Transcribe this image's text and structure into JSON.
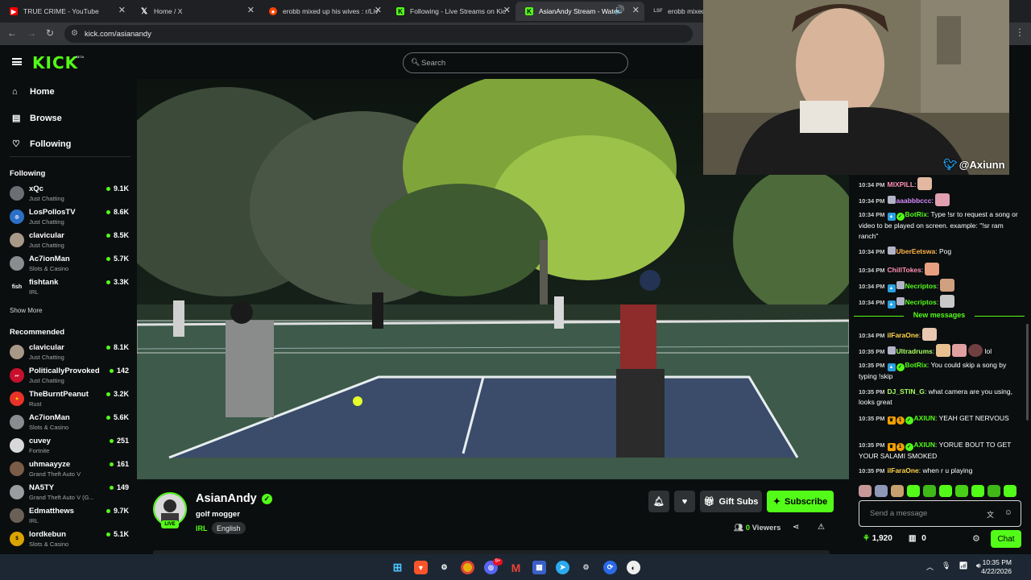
{
  "browser": {
    "tabs": [
      {
        "title": "TRUE CRIME - YouTube",
        "favicon": "youtube-icon"
      },
      {
        "title": "Home / X",
        "favicon": "x-icon"
      },
      {
        "title": "erobb mixed up his wives : r/Liv",
        "favicon": "reddit-icon"
      },
      {
        "title": "Following - Live Streams on Kic",
        "favicon": "kick-icon"
      },
      {
        "title": "AsianAndy Stream - Watch",
        "favicon": "kick-icon"
      },
      {
        "title": "erobb mixed u",
        "favicon": "reddit-icon"
      }
    ],
    "url": "kick.com/asianandy"
  },
  "header": {
    "logo": "KICK",
    "beta": "BETA",
    "search_placeholder": "Search"
  },
  "sidebar": {
    "nav": [
      {
        "label": "Home",
        "icon": "home-icon"
      },
      {
        "label": "Browse",
        "icon": "browse-icon"
      },
      {
        "label": "Following",
        "icon": "heart-icon"
      }
    ],
    "following_title": "Following",
    "following": [
      {
        "name": "xQc",
        "category": "Just Chatting",
        "viewers": "9.1K"
      },
      {
        "name": "LosPollosTV",
        "category": "Just Chatting",
        "viewers": "8.6K"
      },
      {
        "name": "clavicular",
        "category": "Just Chatting",
        "viewers": "8.5K"
      },
      {
        "name": "Ac7ionMan",
        "category": "Slots & Casino",
        "viewers": "5.7K"
      },
      {
        "name": "fishtank",
        "category": "IRL",
        "viewers": "3.3K"
      }
    ],
    "show_more": "Show More",
    "recommended_title": "Recommended",
    "recommended": [
      {
        "name": "clavicular",
        "category": "Just Chatting",
        "viewers": "8.1K"
      },
      {
        "name": "PoliticallyProvoked",
        "category": "Just Chatting",
        "viewers": "142"
      },
      {
        "name": "TheBurntPeanut",
        "category": "Rust",
        "viewers": "3.2K"
      },
      {
        "name": "Ac7ionMan",
        "category": "Slots & Casino",
        "viewers": "5.6K"
      },
      {
        "name": "cuvey",
        "category": "Fortnite",
        "viewers": "251"
      },
      {
        "name": "uhmaayyze",
        "category": "Grand Theft Auto V",
        "viewers": "161"
      },
      {
        "name": "NA5TY",
        "category": "Grand Theft Auto V (G...",
        "viewers": "149"
      },
      {
        "name": "Edmatthews",
        "category": "IRL",
        "viewers": "9.7K"
      },
      {
        "name": "lordkebun",
        "category": "Slots & Casino",
        "viewers": "5.1K"
      }
    ]
  },
  "webcam": {
    "handle": "@Axiunn"
  },
  "stream": {
    "name": "AsianAndy",
    "title": "golf mogger",
    "category": "IRL",
    "language": "English",
    "live_badge": "LIVE",
    "viewers": "0",
    "viewers_label": "Viewers",
    "gift_label": "Gift Subs",
    "subscribe_label": "Subscribe"
  },
  "chat": {
    "messages": [
      {
        "time": "10:34 PM",
        "user": "MIXPILL",
        "text": "",
        "color": "#ff8fb0"
      },
      {
        "time": "10:34 PM",
        "user": "aaabbbccc",
        "text": "",
        "color": "#d98cff"
      },
      {
        "time": "10:34 PM",
        "user": "BotRix",
        "text": "Type !sr to request a song or video to be played on screen. example: \"!sr ram ranch\"",
        "color": "#53fc18"
      },
      {
        "time": "10:34 PM",
        "user": "UberEetswa",
        "text": "Pog",
        "color": "#ffb347"
      },
      {
        "time": "10:34 PM",
        "user": "ChillTokes",
        "text": "",
        "color": "#ff8fb0"
      },
      {
        "time": "10:34 PM",
        "user": "Necriptos",
        "text": "",
        "color": "#53fc18"
      },
      {
        "time": "10:34 PM",
        "user": "Necriptos",
        "text": "",
        "color": "#53fc18"
      },
      {
        "time": "10:34 PM",
        "user": "ilFaraOne",
        "text": "",
        "color": "#ffd447"
      },
      {
        "time": "10:35 PM",
        "user": "Ultradrums",
        "text": "lol",
        "color": "#a8ff60"
      },
      {
        "time": "10:35 PM",
        "user": "BotRix",
        "text": "You could skip a song by typing !skip",
        "color": "#53fc18"
      },
      {
        "time": "10:35 PM",
        "user": "DJ_STIN_G",
        "text": "what camera are you using, looks great",
        "color": "#a8ff60"
      },
      {
        "time": "10:35 PM",
        "user": "AXIUN",
        "text": "YEAH GET NERVOUS",
        "color": "#53fc18"
      },
      {
        "time": "10:35 PM",
        "user": "AXIUN",
        "text": "YORUE BOUT TO GET YOUR SALAMI SMOKED",
        "color": "#53fc18"
      },
      {
        "time": "10:35 PM",
        "user": "ilFaraOne",
        "text": "when r u playing",
        "color": "#ffd447"
      }
    ],
    "new_messages": "New messages",
    "input_placeholder": "Send a message",
    "points": "1,920",
    "gifts": "0",
    "chat_button": "Chat"
  },
  "taskbar": {
    "time": "10:35 PM",
    "date": "4/22/2026",
    "discord_badge": "9+"
  }
}
